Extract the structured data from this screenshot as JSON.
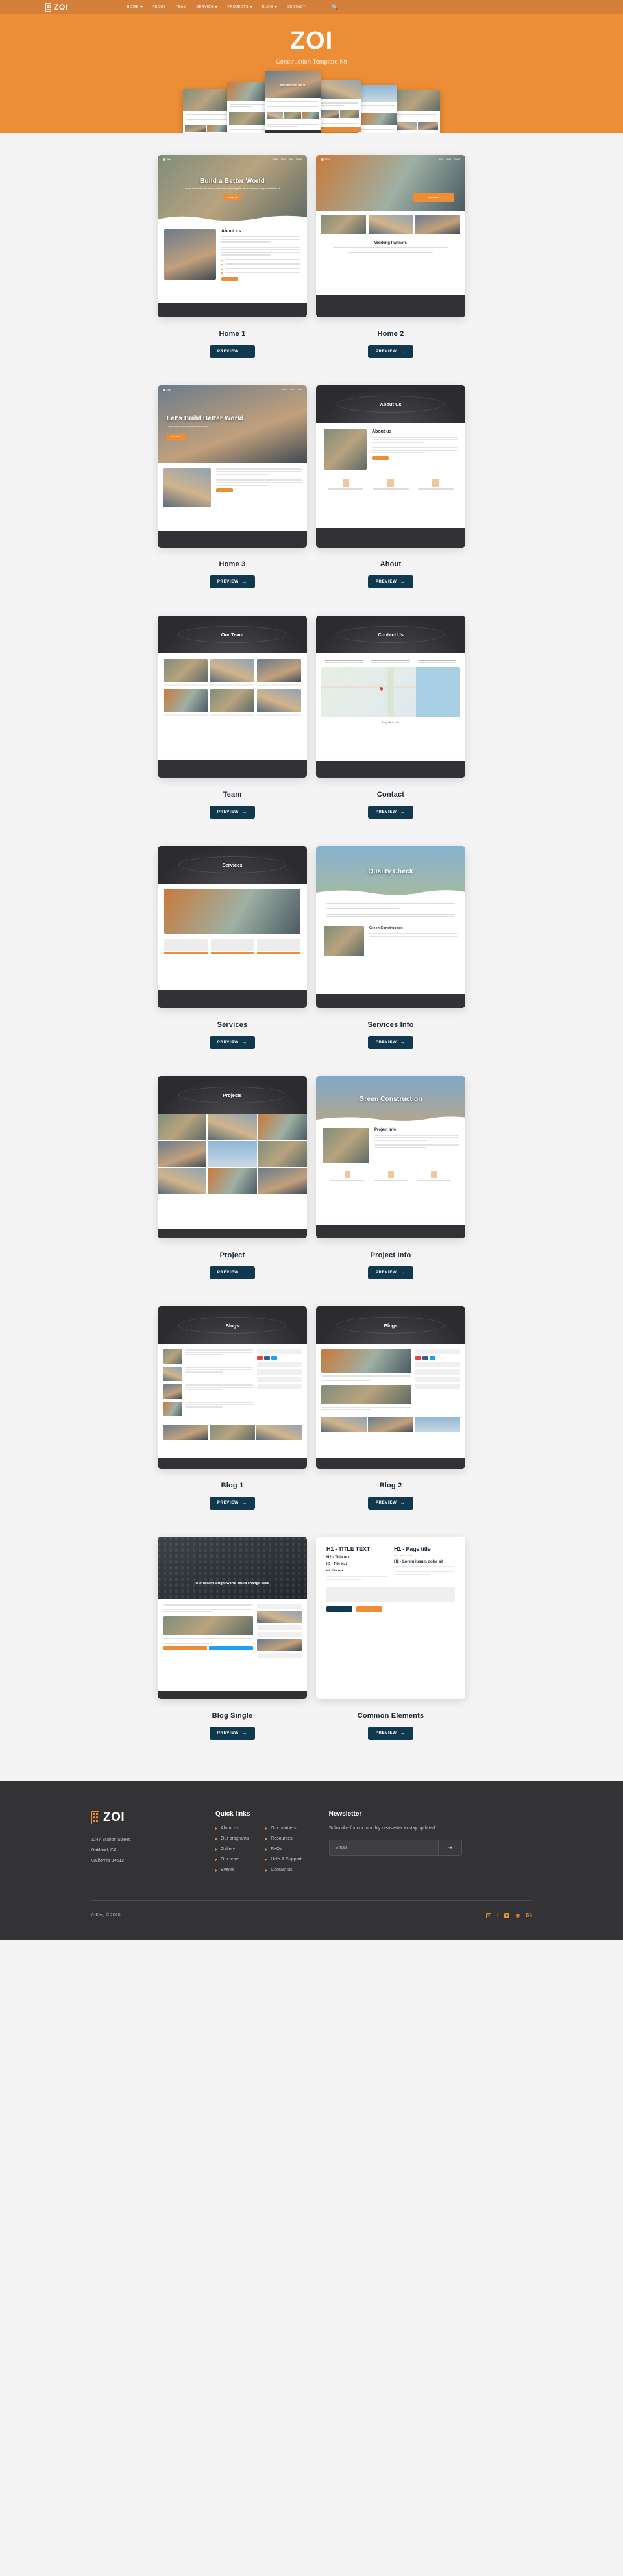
{
  "header": {
    "brand": "ZOI",
    "brand_icon": "building-icon",
    "nav": [
      {
        "label": "HOME",
        "has_caret": true
      },
      {
        "label": "ABOUT",
        "has_caret": false
      },
      {
        "label": "TEAM",
        "has_caret": false
      },
      {
        "label": "SERVICE",
        "has_caret": true
      },
      {
        "label": "PROJECTS",
        "has_caret": true
      },
      {
        "label": "BLOG",
        "has_caret": true
      },
      {
        "label": "CONTACT",
        "has_caret": false
      }
    ],
    "search_icon": "search-icon"
  },
  "hero": {
    "title": "ZOI",
    "subtitle": "Construction Template Kit"
  },
  "colors": {
    "brand_orange": "#ed8d35",
    "topbar_orange": "#d4803b",
    "button_navy": "#10394f",
    "footer_dark": "#333336"
  },
  "cards": [
    {
      "label": "Home 1",
      "button": "PREVIEW",
      "arrow": "→",
      "thumb_title": "Build a Better World",
      "thumb_sub": "Lorem ipsum dolor sit amet, consectetur adipiscing elit, sed do eiusmod tempor incididunt ut",
      "thumb_cta": "Contact Us",
      "section_title": "About us"
    },
    {
      "label": "Home 2",
      "button": "PREVIEW",
      "arrow": "→",
      "thumb_title": "Working Partners",
      "badge": "Get a quote"
    },
    {
      "label": "Home 3",
      "button": "PREVIEW",
      "arrow": "→",
      "thumb_title": "Let's Build Better World",
      "thumb_sub": "Lorem ipsum dolor sit amet consectetur",
      "thumb_cta": "Contact Us"
    },
    {
      "label": "About",
      "button": "PREVIEW",
      "arrow": "→",
      "thumb_title": "About Us",
      "section_title": "About us"
    },
    {
      "label": "Team",
      "button": "PREVIEW",
      "arrow": "→",
      "thumb_title": "Our Team"
    },
    {
      "label": "Contact",
      "button": "PREVIEW",
      "arrow": "→",
      "thumb_title": "Contact Us",
      "map_caption": "Map Us & Like"
    },
    {
      "label": "Services",
      "button": "PREVIEW",
      "arrow": "→",
      "thumb_title": "Services"
    },
    {
      "label": "Services Info",
      "button": "PREVIEW",
      "arrow": "→",
      "thumb_title": "Quality Check",
      "section_title": "Green Construction"
    },
    {
      "label": "Project",
      "button": "PREVIEW",
      "arrow": "→",
      "thumb_title": "Projects"
    },
    {
      "label": "Project Info",
      "button": "PREVIEW",
      "arrow": "→",
      "thumb_title": "Green Construction",
      "section_title": "Project Info"
    },
    {
      "label": "Blog 1",
      "button": "PREVIEW",
      "arrow": "→",
      "thumb_title": "Blogs"
    },
    {
      "label": "Blog 2",
      "button": "PREVIEW",
      "arrow": "→",
      "thumb_title": "Blogs"
    },
    {
      "label": "Blog Single",
      "button": "PREVIEW",
      "arrow": "→",
      "thumb_title": "Our dream, bright world could change lives"
    },
    {
      "label": "Common Elements",
      "button": "PREVIEW",
      "arrow": "→",
      "elements": {
        "h1_left": "H1 - TITLE TEXT",
        "h2_left": "H2 - Title text",
        "h3_left": "H3 - Title text",
        "h4_left": "H4 - Title text",
        "h1_right": "H1 - Page title",
        "label_right": "PILL - SMALL TEXT",
        "h2_right": "H2 - Lorem ipsum dolor sit",
        "body_right": "H3 - Lorem ipsum dolor sit amet, consectetur adipiscing elit, sed do eiusmod."
      }
    }
  ],
  "footer": {
    "brand": "ZOI",
    "brand_icon": "building-icon",
    "address_line1": "2247  Station Street,",
    "address_line2": "Oakland, CA,",
    "address_line3": "California 94612",
    "quick_links_heading": "Quick links",
    "quick_links_col1": [
      "About us",
      "Our programs",
      "Gallery",
      "Our team",
      "Events"
    ],
    "quick_links_col2": [
      "Our partners",
      "Resources",
      "FAQs",
      "Help & Support",
      "Contact us"
    ],
    "newsletter_heading": "Newsletter",
    "newsletter_text": "Subscribe for our monthly newsletter to stay updated",
    "email_placeholder": "Email",
    "email_value": "",
    "submit_arrow": "➞",
    "copyright": "C-Kav, © 2020",
    "social": [
      {
        "name": "instagram-icon",
        "glyph": "◎"
      },
      {
        "name": "facebook-icon",
        "glyph": "f"
      },
      {
        "name": "youtube-icon",
        "glyph": "▶"
      },
      {
        "name": "dribbble-icon",
        "glyph": "◉"
      },
      {
        "name": "behance-icon",
        "glyph": "Bē"
      }
    ]
  }
}
